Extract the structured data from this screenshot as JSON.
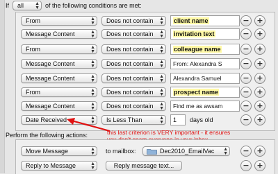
{
  "header": {
    "if_label": "If",
    "match_value": "all",
    "conditions_label": "of the following conditions are met:"
  },
  "conditions": [
    {
      "field": "From",
      "operator": "Does not contain",
      "value": "client name",
      "highlight": true
    },
    {
      "field": "Message Content",
      "operator": "Does not contain",
      "value": "invitation text",
      "highlight": true
    },
    {
      "field": "From",
      "operator": "Does not contain",
      "value": "colleague name",
      "highlight": true
    },
    {
      "field": "Message Content",
      "operator": "Does not contain",
      "value": "From: Alexandra S",
      "highlight": false
    },
    {
      "field": "Message Content",
      "operator": "Does not contain",
      "value": "Alexandra Samuel",
      "highlight": false
    },
    {
      "field": "From",
      "operator": "Does not contain",
      "value": "prospect name",
      "highlight": true
    },
    {
      "field": "Message Content",
      "operator": "Does not contain",
      "value": "Find me as awsam",
      "highlight": false
    }
  ],
  "date_condition": {
    "field": "Date Received",
    "operator": "Is Less Than",
    "value": "1",
    "unit": "days old"
  },
  "annotation": {
    "line1": "this last criterion is VERY important - it ensures",
    "line2": "you don't spam everyone in your inbox"
  },
  "actions_label": "Perform the following actions:",
  "actions": {
    "move": {
      "action": "Move Message",
      "to_label": "to mailbox:",
      "mailbox": "Dec2010_EmailVac",
      "mailbox_icon": "folder-icon"
    },
    "reply": {
      "action": "Reply to Message",
      "button": "Reply message text..."
    }
  },
  "buttons": {
    "remove": "−",
    "add": "+"
  },
  "colors": {
    "annotation": "#e01010",
    "highlight": "#fff9a6"
  }
}
